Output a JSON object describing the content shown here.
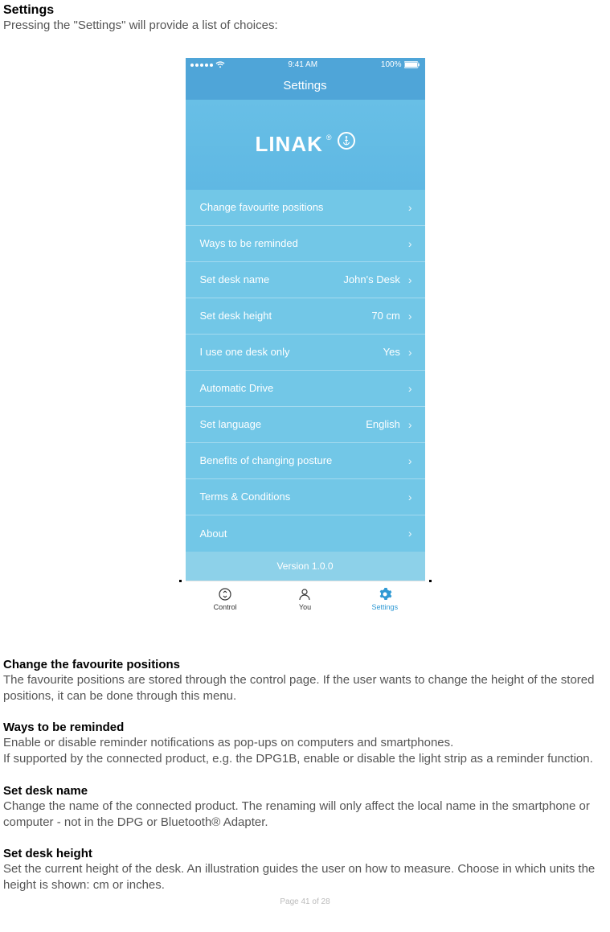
{
  "doc": {
    "title": "Settings",
    "intro": "Pressing the \"Settings\" will provide a list of choices:"
  },
  "phone": {
    "status": {
      "time": "9:41 AM",
      "battery": "100%"
    },
    "navbar_title": "Settings",
    "logo_text": "LINAK",
    "rows": [
      {
        "label": "Change favourite positions",
        "value": ""
      },
      {
        "label": "Ways to be reminded",
        "value": ""
      },
      {
        "label": "Set desk name",
        "value": "John's Desk"
      },
      {
        "label": "Set desk height",
        "value": "70 cm"
      },
      {
        "label": "I use one desk only",
        "value": "Yes"
      },
      {
        "label": "Automatic Drive",
        "value": ""
      },
      {
        "label": "Set language",
        "value": "English"
      },
      {
        "label": "Benefits of changing posture",
        "value": ""
      },
      {
        "label": "Terms & Conditions",
        "value": ""
      },
      {
        "label": "About",
        "value": ""
      }
    ],
    "version": "Version 1.0.0",
    "tabs": [
      {
        "label": "Control"
      },
      {
        "label": "You"
      },
      {
        "label": "Settings"
      }
    ]
  },
  "sections": [
    {
      "heading": "Change the favourite positions",
      "body": "The favourite positions are stored through the control page. If the user wants to change the height of the stored positions, it can be done through this menu."
    },
    {
      "heading": "Ways to be reminded",
      "body": "Enable or disable reminder notifications as pop-ups on computers and smartphones.\nIf supported by the connected product, e.g. the DPG1B, enable or disable the light strip as a reminder function."
    },
    {
      "heading": "Set desk name",
      "body": "Change the name of the connected product. The renaming will only affect the local name in the smartphone or computer - not in the DPG or Bluetooth® Adapter."
    },
    {
      "heading": "Set desk height",
      "body": "Set the current height of the desk. An illustration guides the user on how to measure. Choose in which units the height is shown: cm or inches."
    }
  ],
  "page_footer": "Page 41 of 28"
}
